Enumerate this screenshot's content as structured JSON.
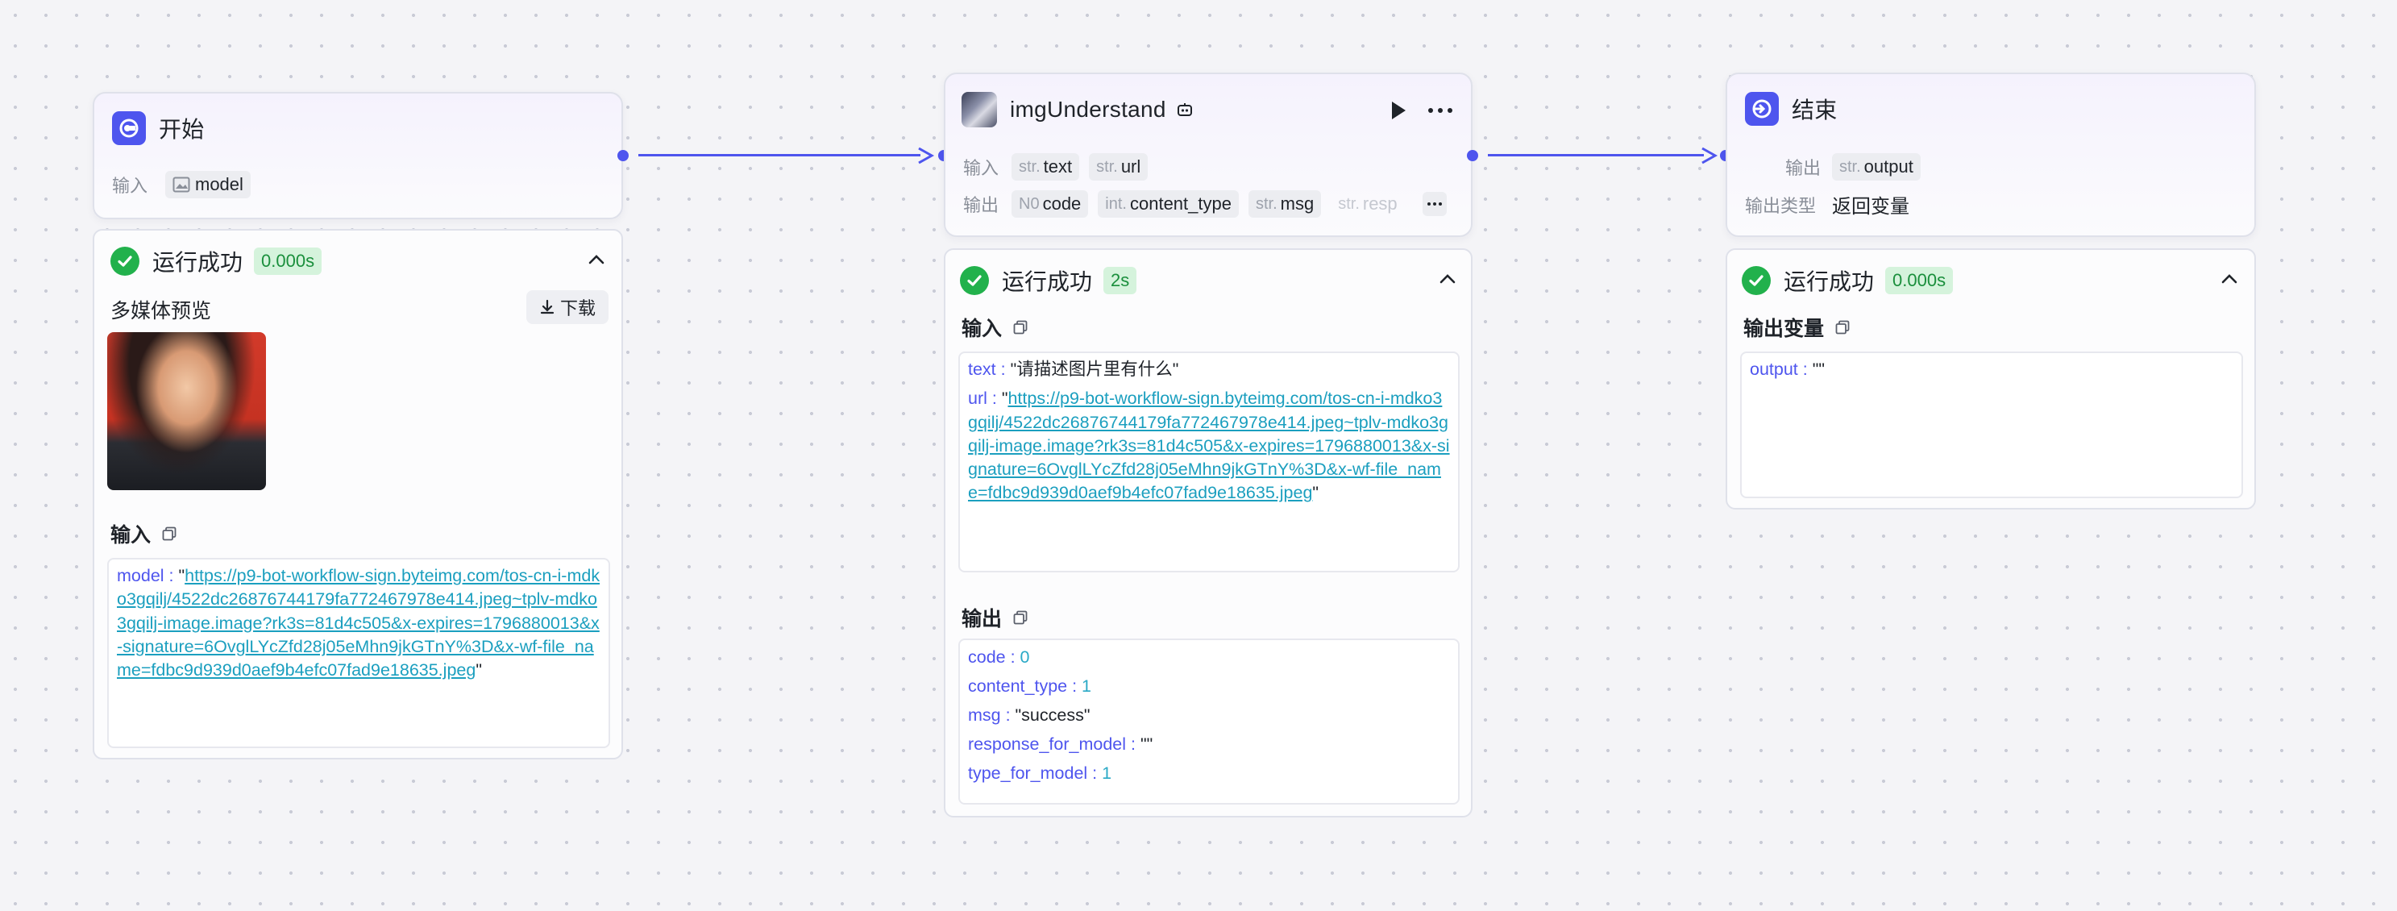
{
  "start_node": {
    "title": "开始",
    "input_label": "输入",
    "input_tag": "model",
    "result": {
      "status": "运行成功",
      "duration": "0.000s",
      "media_title": "多媒体预览",
      "download_label": "下载",
      "input_section": "输入",
      "model_key": "model",
      "model_url": "https://p9-bot-workflow-sign.byteimg.com/tos-cn-i-mdko3gqilj/4522dc26876744179fa772467978e414.jpeg~tplv-mdko3gqilj-image.image?rk3s=81d4c505&x-expires=1796880013&x-signature=6OvglLYcZfd28j05eMhn9jkGTnY%3D&x-wf-file_name=fdbc9d939d0aef9b4efc07fad9e18635.jpeg"
    }
  },
  "img_node": {
    "title": "imgUnderstand",
    "input_label": "输入",
    "output_label": "输出",
    "inputs": [
      {
        "type": "str.",
        "name": "text"
      },
      {
        "type": "str.",
        "name": "url"
      }
    ],
    "outputs": [
      {
        "type": "N0",
        "name": "code"
      },
      {
        "type": "int.",
        "name": "content_type"
      },
      {
        "type": "str.",
        "name": "msg"
      },
      {
        "type": "str.",
        "name": "resp"
      }
    ],
    "result": {
      "status": "运行成功",
      "duration": "2s",
      "input_section": "输入",
      "text_key": "text",
      "text_value": "\"请描述图片里有什么\"",
      "url_key": "url",
      "url_value": "https://p9-bot-workflow-sign.byteimg.com/tos-cn-i-mdko3gqilj/4522dc26876744179fa772467978e414.jpeg~tplv-mdko3gqilj-image.image?rk3s=81d4c505&x-expires=1796880013&x-signature=6OvglLYcZfd28j05eMhn9jkGTnY%3D&x-wf-file_name=fdbc9d939d0aef9b4efc07fad9e18635.jpeg",
      "output_section": "输出",
      "outputs": [
        {
          "key": "code",
          "value": "0"
        },
        {
          "key": "content_type",
          "value": "1"
        },
        {
          "key": "msg",
          "value": "\"success\""
        },
        {
          "key": "response_for_model",
          "value": "\"\""
        },
        {
          "key": "type_for_model",
          "value": "1"
        }
      ]
    }
  },
  "end_node": {
    "title": "结束",
    "output_label": "输出",
    "output_tag_type": "str.",
    "output_tag": "output",
    "output_type_label": "输出类型",
    "output_type_value": "返回变量",
    "result": {
      "status": "运行成功",
      "duration": "0.000s",
      "section": "输出变量",
      "output_key": "output",
      "output_value": "\"\""
    }
  },
  "colors": {
    "accent": "#4e55ee",
    "success": "#22b14c",
    "link": "#1b9fbf",
    "key": "#4e55ee",
    "number": "#2aa9c6"
  }
}
